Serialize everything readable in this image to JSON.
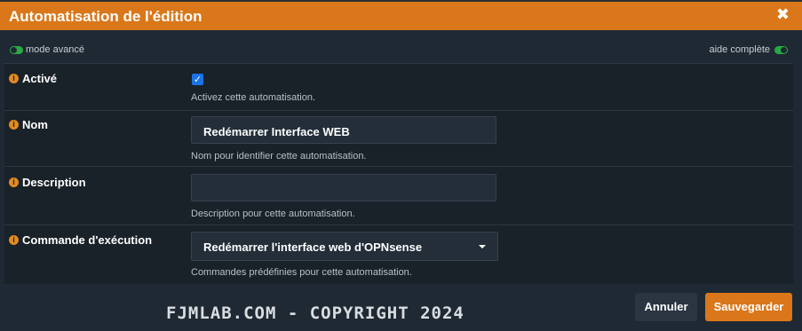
{
  "dialog": {
    "title": "Automatisation de l'édition",
    "close_glyph": "✖"
  },
  "mode_bar": {
    "left_label": "mode avancé",
    "right_label": "aide complète",
    "toggle_color": "#2aa843"
  },
  "fields": {
    "enabled": {
      "label": "Activé",
      "checked": true,
      "help": "Activez cette automatisation."
    },
    "name": {
      "label": "Nom",
      "value": "Redémarrer Interface WEB",
      "help": "Nom pour identifier cette automatisation."
    },
    "description": {
      "label": "Description",
      "value": "",
      "help": "Description pour cette automatisation."
    },
    "command": {
      "label": "Commande d'exécution",
      "selected": "Redémarrer l'interface web d'OPNsense",
      "help": "Commandes prédéfinies pour cette automatisation."
    }
  },
  "buttons": {
    "cancel": "Annuler",
    "save": "Sauvegarder"
  },
  "watermark": "FJMLAB.COM - COPYRIGHT 2024",
  "icons": {
    "info": "info-circle-icon",
    "checkmark": "✓"
  },
  "colors": {
    "accent": "#d9771a",
    "panel": "#1f2934",
    "checkbox": "#1a73e8"
  }
}
